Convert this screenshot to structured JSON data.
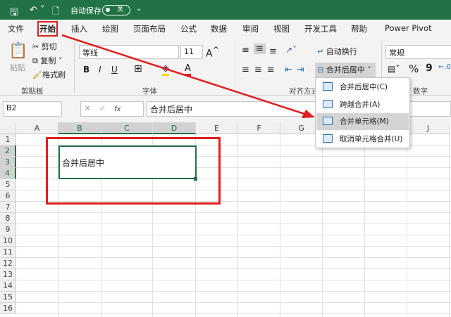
{
  "titlebar": {
    "autosave_label": "自动保存",
    "autosave_state": "关"
  },
  "tabs": [
    "文件",
    "开始",
    "插入",
    "绘图",
    "页面布局",
    "公式",
    "数据",
    "审阅",
    "视图",
    "开发工具",
    "帮助",
    "Power Pivot"
  ],
  "ribbon": {
    "clipboard": {
      "paste": "粘贴",
      "cut": "剪切",
      "copy": "复制",
      "format_painter": "格式刷",
      "group": "剪贴板"
    },
    "font": {
      "name": "等线",
      "size": "11",
      "bold": "B",
      "italic": "I",
      "underline": "U",
      "font_color": "A",
      "group": "字体"
    },
    "alignment": {
      "wrap": "自动换行",
      "merge_center": "合并后居中",
      "group": "对齐方式"
    },
    "number": {
      "format": "常规",
      "percent": "%",
      "comma": "9",
      "group": "数字"
    }
  },
  "formula_bar": {
    "name_box": "B2",
    "fx": "fx",
    "value": "合并后居中"
  },
  "columns": [
    "A",
    "B",
    "C",
    "D",
    "E",
    "F",
    "G",
    "H",
    "I",
    "J"
  ],
  "rows": [
    "1",
    "2",
    "3",
    "4",
    "5",
    "6",
    "7",
    "8",
    "9",
    "10",
    "11",
    "12",
    "13",
    "14",
    "15",
    "16"
  ],
  "cell_B2": "合并后居中",
  "merge_menu": [
    {
      "label": "合并后居中(C)"
    },
    {
      "label": "跨越合并(A)"
    },
    {
      "label": "合并单元格(M)"
    },
    {
      "label": "取消单元格合并(U)"
    }
  ],
  "colors": {
    "excel_green": "#217346",
    "annotation_red": "#e01e1e"
  }
}
